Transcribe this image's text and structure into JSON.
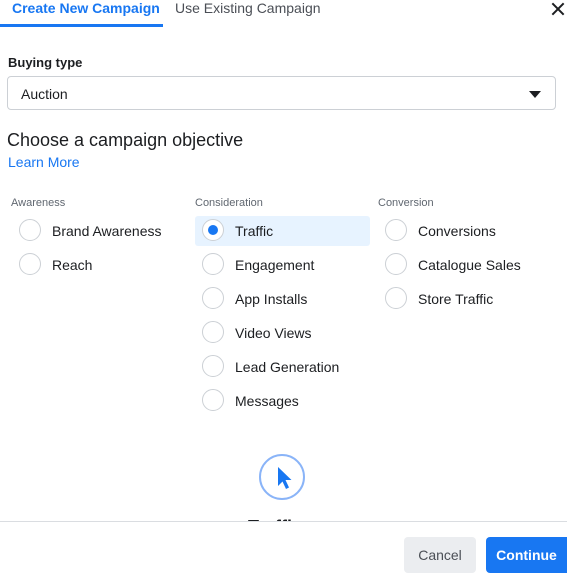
{
  "tabs": {
    "create_new": "Create New Campaign",
    "use_existing": "Use Existing Campaign"
  },
  "buying_type": {
    "label": "Buying type",
    "value": "Auction"
  },
  "objective": {
    "title": "Choose a campaign objective",
    "learn_more": "Learn More"
  },
  "columns": [
    {
      "header": "Awareness",
      "options": [
        "Brand Awareness",
        "Reach"
      ]
    },
    {
      "header": "Consideration",
      "options": [
        "Traffic",
        "Engagement",
        "App Installs",
        "Video Views",
        "Lead Generation",
        "Messages"
      ]
    },
    {
      "header": "Conversion",
      "options": [
        "Conversions",
        "Catalogue Sales",
        "Store Traffic"
      ]
    }
  ],
  "selected_objective": "Traffic",
  "preview": {
    "icon": "cursor-icon",
    "title_partial": "Traffic"
  },
  "footer": {
    "cancel": "Cancel",
    "continue": "Continue"
  },
  "colors": {
    "accent": "#1877f2",
    "selected_bg": "#e7f3ff"
  }
}
